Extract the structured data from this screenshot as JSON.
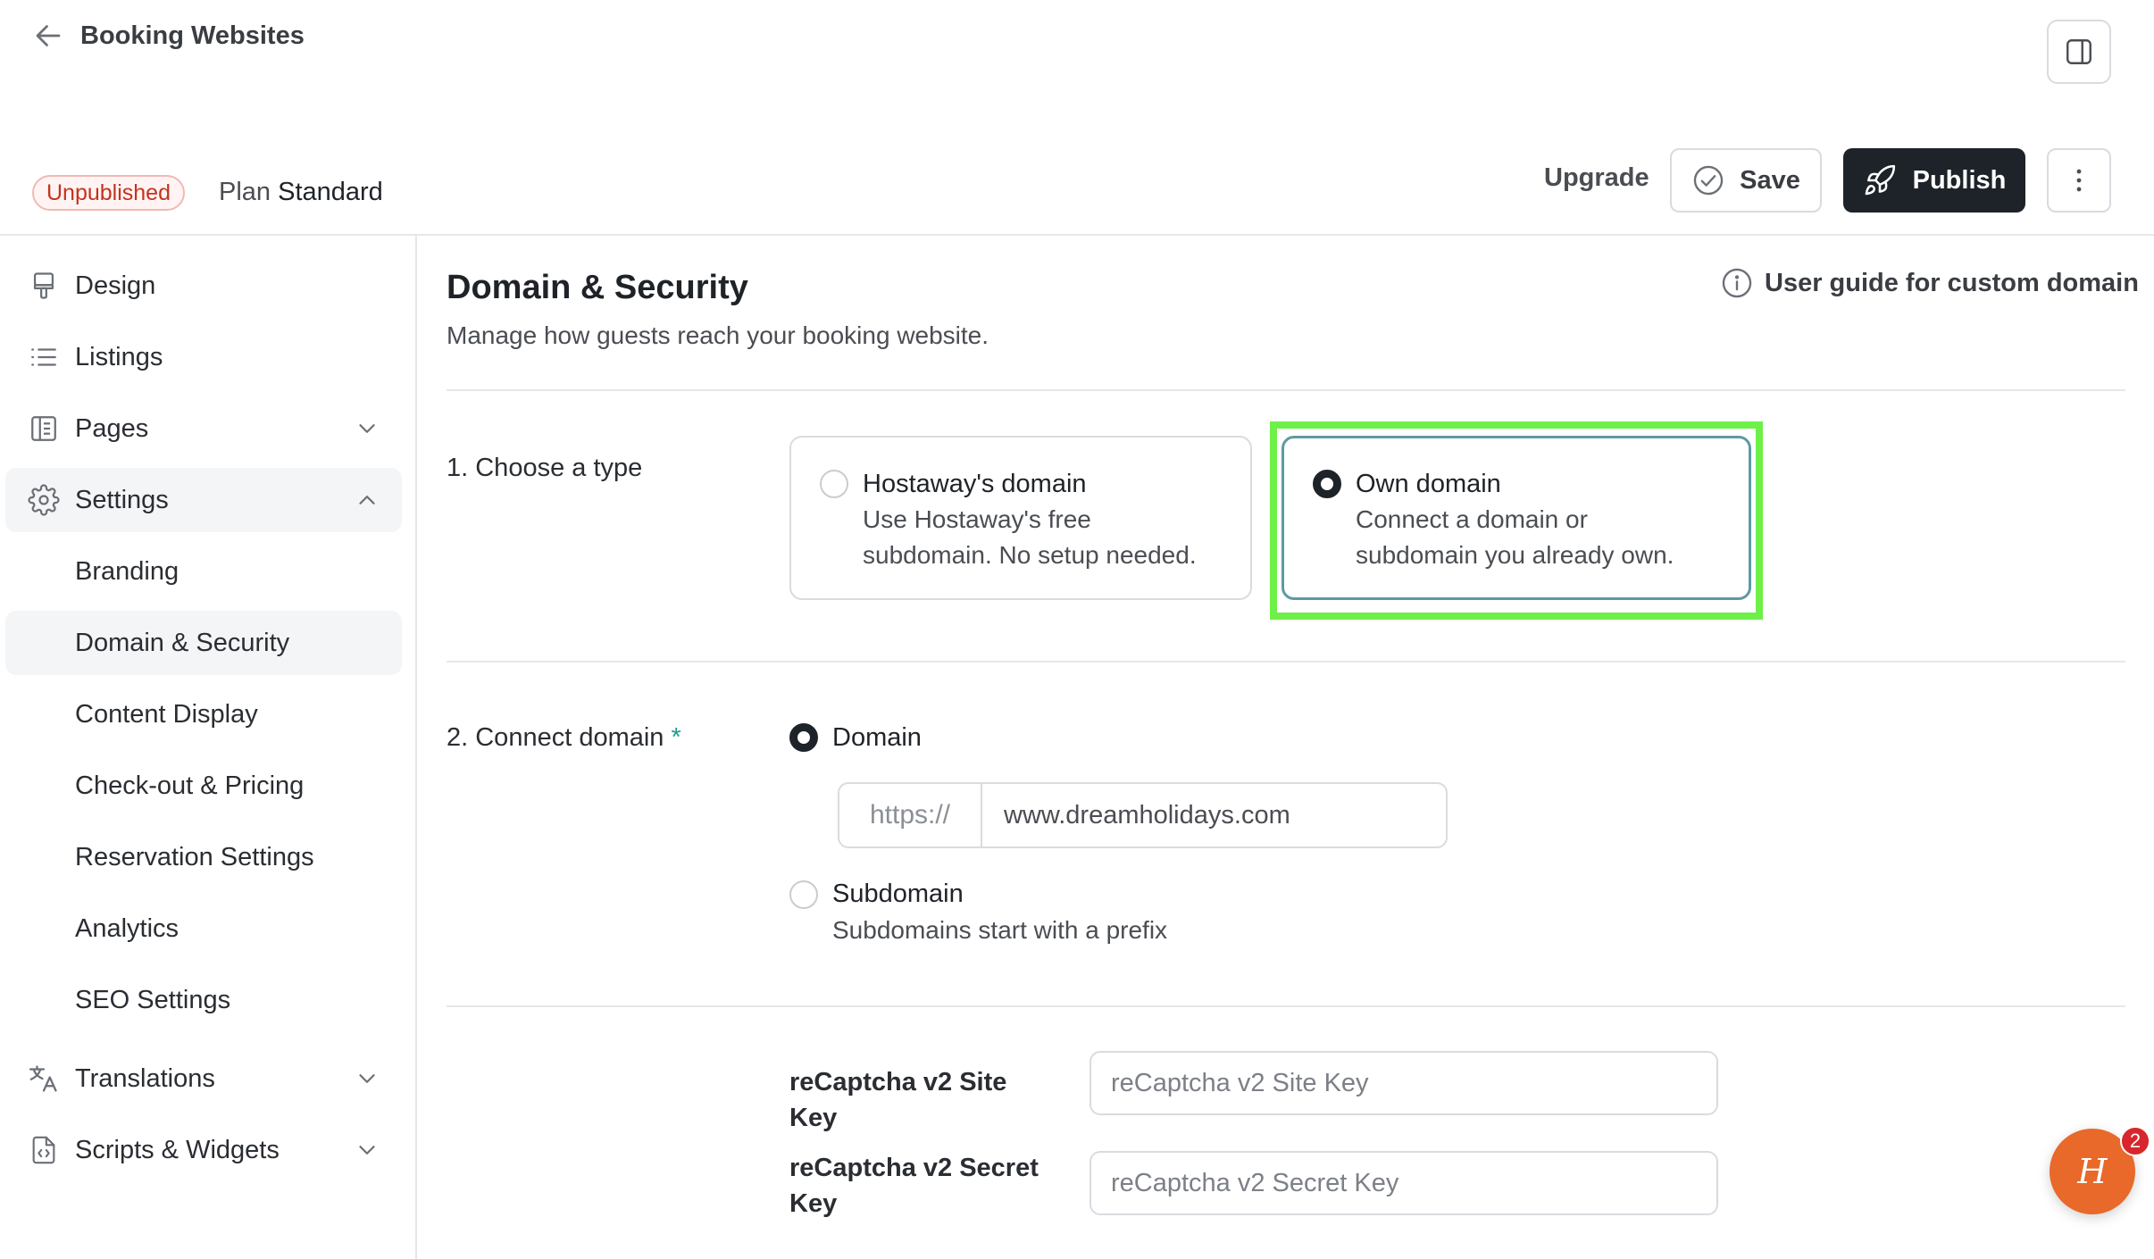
{
  "header": {
    "back_label": "Booking Websites",
    "status_badge": "Unpublished",
    "plan_prefix": "Plan",
    "plan_name": "Standard",
    "upgrade_label": "Upgrade",
    "save_label": "Save",
    "publish_label": "Publish"
  },
  "sidebar": {
    "items": [
      {
        "label": "Design",
        "icon": "paint-roller-icon"
      },
      {
        "label": "Listings",
        "icon": "list-icon"
      },
      {
        "label": "Pages",
        "icon": "pages-icon"
      },
      {
        "label": "Settings",
        "icon": "gear-icon"
      }
    ],
    "settings_children": [
      "Branding",
      "Domain & Security",
      "Content Display",
      "Check-out & Pricing",
      "Reservation Settings",
      "Analytics",
      "SEO Settings"
    ],
    "bottom_items": [
      {
        "label": "Translations",
        "icon": "translate-icon"
      },
      {
        "label": "Scripts & Widgets",
        "icon": "code-file-icon"
      }
    ]
  },
  "main": {
    "title": "Domain & Security",
    "subtitle": "Manage how guests reach your booking website.",
    "guide_link": "User guide for custom domain",
    "step1_label": "1. Choose a type",
    "hostaway_card": {
      "title": "Hostaway's domain",
      "desc_line1": "Use Hostaway's free",
      "desc_line2": "subdomain. No setup needed.",
      "selected": false
    },
    "own_card": {
      "title": "Own domain",
      "desc_line1": "Connect a domain or",
      "desc_line2": "subdomain you already own.",
      "selected": true
    },
    "step2_label": "2. Connect domain",
    "required_mark": "*",
    "domain_option": "Domain",
    "domain_prefix": "https://",
    "domain_value": "www.dreamholidays.com",
    "subdomain_option": "Subdomain",
    "subdomain_desc": "Subdomains start with a prefix",
    "recaptcha_site_label": "reCaptcha v2 Site Key",
    "recaptcha_site_placeholder": "reCaptcha v2 Site Key",
    "recaptcha_secret_label": "reCaptcha v2 Secret Key",
    "recaptcha_secret_placeholder": "reCaptcha v2 Secret Key"
  },
  "chat": {
    "icon_letter": "H",
    "badge_count": "2"
  },
  "colors": {
    "accent_highlight": "#6ef049",
    "primary_dark": "#1e2329",
    "badge_red": "#c4321f",
    "chat_orange": "#e8692a"
  }
}
